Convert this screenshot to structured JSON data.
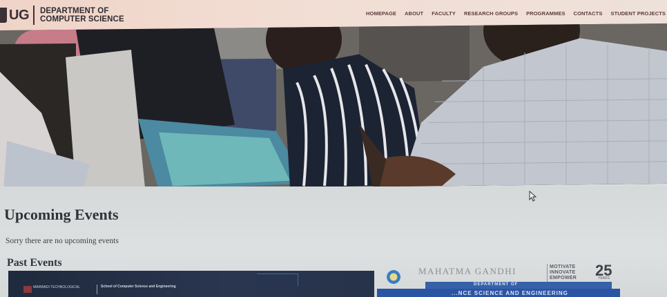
{
  "header": {
    "logo_ug": "UG",
    "dept_line1": "DEPARTMENT OF",
    "dept_line2": "COMPUTER SCIENCE",
    "nav": [
      "HOMEPAGE",
      "ABOUT",
      "FACULTY",
      "RESEARCH GROUPS",
      "PROGRAMMES",
      "CONTACTS",
      "STUDENT PROJECTS"
    ]
  },
  "content": {
    "upcoming_title": "Upcoming Events",
    "no_events": "Sorry there are no upcoming events",
    "past_title": "Past Events"
  },
  "past_events": {
    "card1": {
      "left_text": "MARWADI TECHNOLOGICAL",
      "right_text": "School of Computer Science and Engineering"
    },
    "card2": {
      "title": "MAHATMA GANDHI",
      "motto": [
        "MOTIVATE",
        "INNOVATE",
        "EMPOWER"
      ],
      "number": "25",
      "number_sub": "YEARS",
      "dept_bar": "DEPARTMENT OF",
      "bottom_bar": "...NCE SCIENCE AND ENGINEERING"
    }
  },
  "colors": {
    "header_bg": "#f0d8cd",
    "nav_text": "#5b3b3c",
    "heading_text": "#2e3338",
    "page_bg": "#d9dcdc",
    "banner_blue": "#2b54a3"
  }
}
